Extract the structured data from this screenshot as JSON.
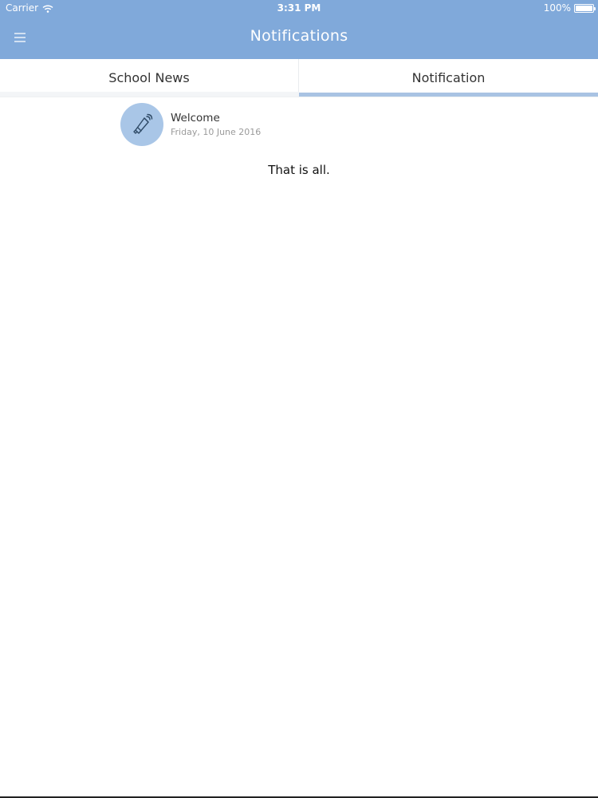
{
  "status_bar": {
    "carrier": "Carrier",
    "time": "3:31 PM",
    "battery": "100%",
    "wifi_icon": "wifi-icon",
    "battery_icon": "battery-icon"
  },
  "header": {
    "title": "Notifications",
    "menu_icon": "hamburger-menu-icon",
    "background_color": "#80a9da"
  },
  "tabs": [
    {
      "label": "School News",
      "selected": false
    },
    {
      "label": "Notification",
      "selected": true
    }
  ],
  "notifications": [
    {
      "title": "Welcome",
      "date": "Friday, 10 June 2016",
      "icon": "megaphone-icon"
    }
  ],
  "footer_text": "That is all.",
  "colors": {
    "accent": "#a9c3e3",
    "avatar_bg": "#a9c6e7",
    "icon_stroke": "#2f4a66"
  }
}
